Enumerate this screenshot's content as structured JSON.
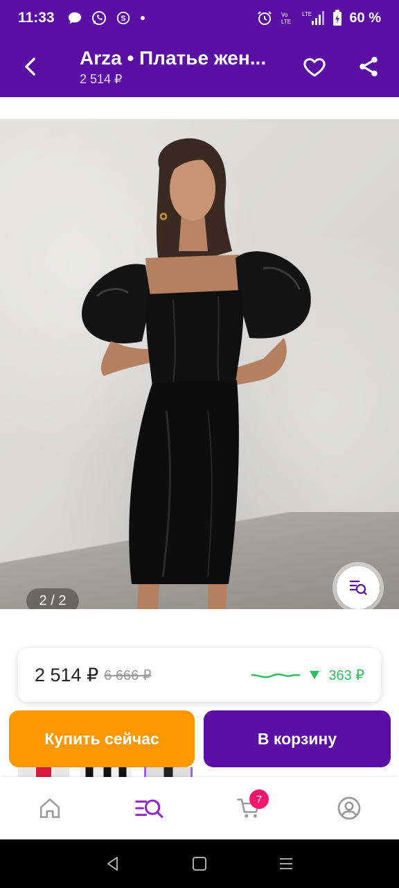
{
  "status_bar": {
    "time": "11:33",
    "battery": "60 %",
    "icons_left": [
      "message-icon",
      "whatsapp-icon",
      "skype-icon",
      "dot-icon"
    ],
    "icons_right": [
      "alarm-icon",
      "volte-icon",
      "lte-signal-icon",
      "battery-icon"
    ]
  },
  "app_bar": {
    "title": "Arza • Платье жен...",
    "subtitle": "2 514 ₽"
  },
  "gallery": {
    "counter": "2 / 2"
  },
  "price_card": {
    "current": "2 514 ₽",
    "old": "6 666 ₽",
    "trend_value": "363 ₽"
  },
  "actions": {
    "buy_now": "Купить сейчас",
    "add_to_cart": "В корзину"
  },
  "bottom_nav": {
    "items": [
      "home-icon",
      "catalog-search-icon",
      "cart-icon",
      "profile-icon"
    ],
    "cart_badge": "7"
  },
  "colors": {
    "brand": "#5b0ea3",
    "accent_orange": "#ff9800",
    "trend_green": "#2ebd5d",
    "badge_pink": "#f5166d"
  }
}
